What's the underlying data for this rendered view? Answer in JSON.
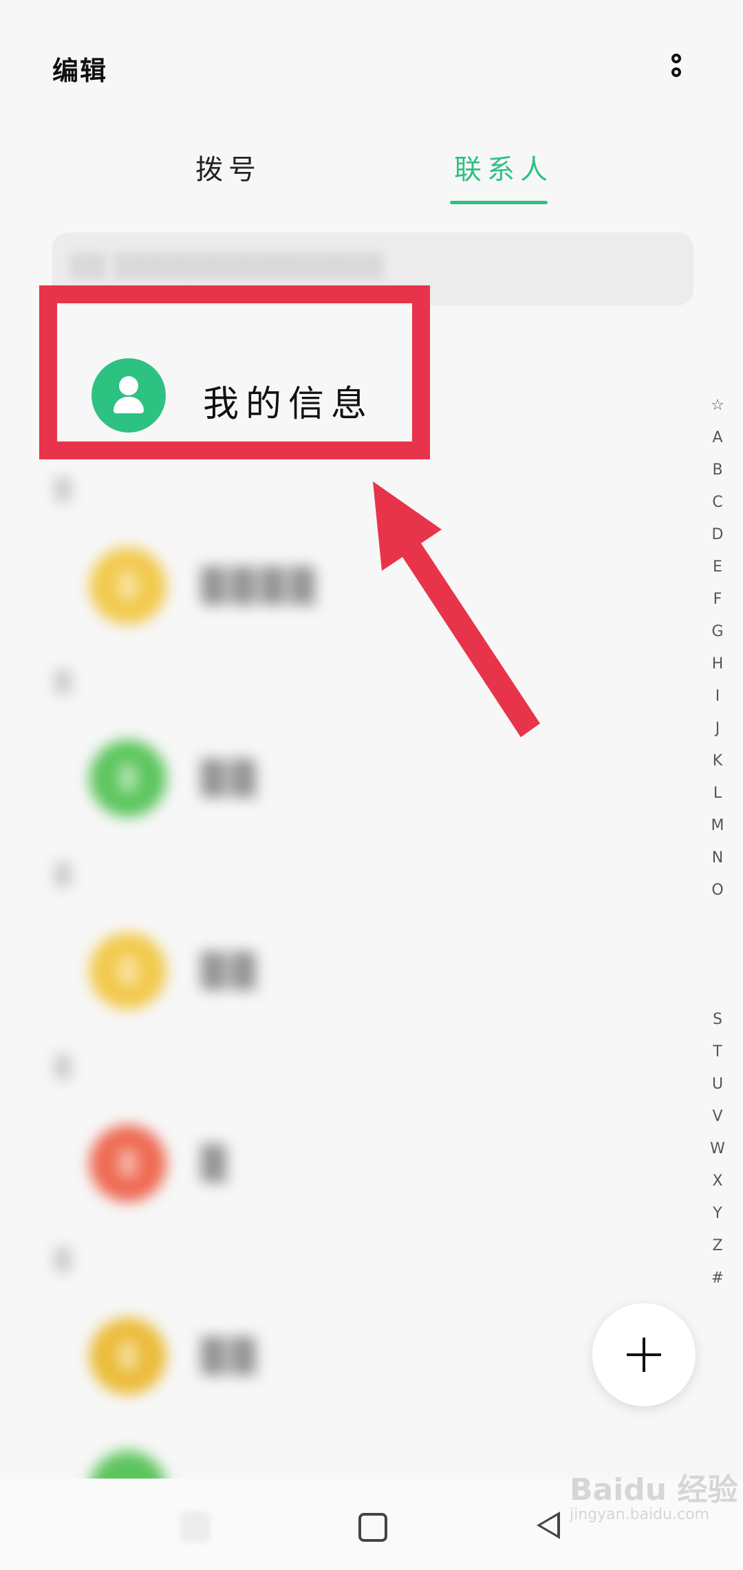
{
  "header": {
    "edit_label": "编辑"
  },
  "tabs": [
    {
      "label": "拨号"
    },
    {
      "label": "联系人"
    }
  ],
  "my_info": {
    "label": "我的信息"
  },
  "alpha_index": [
    "☆",
    "A",
    "B",
    "C",
    "D",
    "E",
    "F",
    "G",
    "H",
    "I",
    "J",
    "K",
    "L",
    "M",
    "N",
    "O",
    "",
    "",
    "",
    "S",
    "T",
    "U",
    "V",
    "W",
    "X",
    "Y",
    "Z",
    "#"
  ],
  "colors": {
    "accent": "#2fc182",
    "highlight": "#e8344a"
  },
  "watermark": {
    "text": "Baidu 经验",
    "sub": "jingyan.baidu.com"
  }
}
